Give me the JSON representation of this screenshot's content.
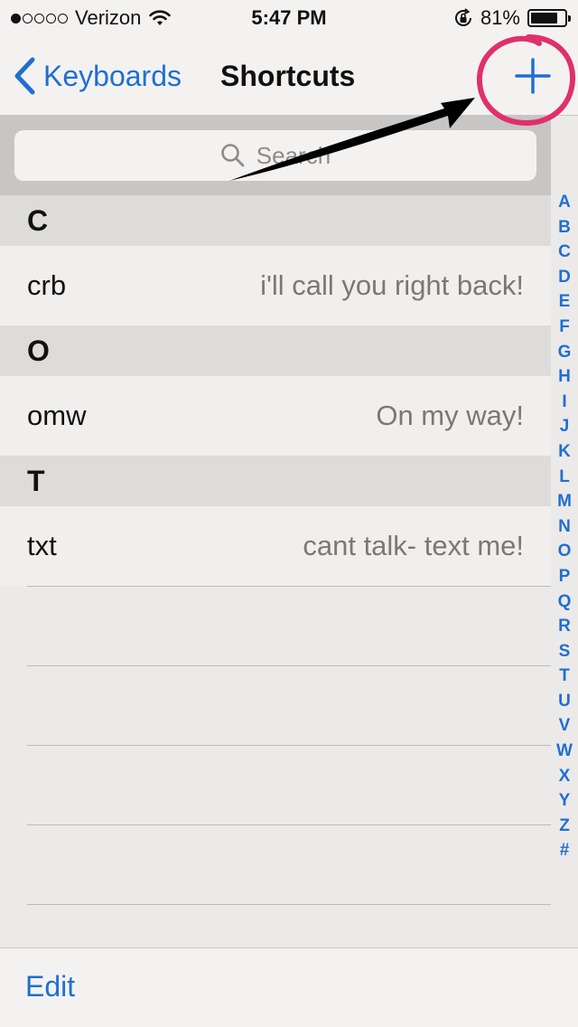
{
  "status_bar": {
    "carrier": "Verizon",
    "time": "5:47 PM",
    "battery_percent": "81%",
    "signal_bars_filled": 1,
    "signal_bars_total": 5,
    "battery_level": 0.81
  },
  "nav": {
    "back_label": "Keyboards",
    "title": "Shortcuts",
    "accent_color": "#1f6fd1"
  },
  "search": {
    "placeholder": "Search"
  },
  "sections": [
    {
      "letter": "C",
      "phrase": "crb",
      "shortcut": "i'll call you right back!"
    },
    {
      "letter": "O",
      "phrase": "omw",
      "shortcut": "On my way!"
    },
    {
      "letter": "T",
      "phrase": "txt",
      "shortcut": "cant talk- text me!"
    }
  ],
  "index_letters": [
    "A",
    "B",
    "C",
    "D",
    "E",
    "F",
    "G",
    "H",
    "I",
    "J",
    "K",
    "L",
    "M",
    "N",
    "O",
    "P",
    "Q",
    "R",
    "S",
    "T",
    "U",
    "V",
    "W",
    "X",
    "Y",
    "Z",
    "#"
  ],
  "toolbar": {
    "edit_label": "Edit"
  },
  "annotation": {
    "circle_color": "#e0306e",
    "arrow_color": "#000000"
  }
}
